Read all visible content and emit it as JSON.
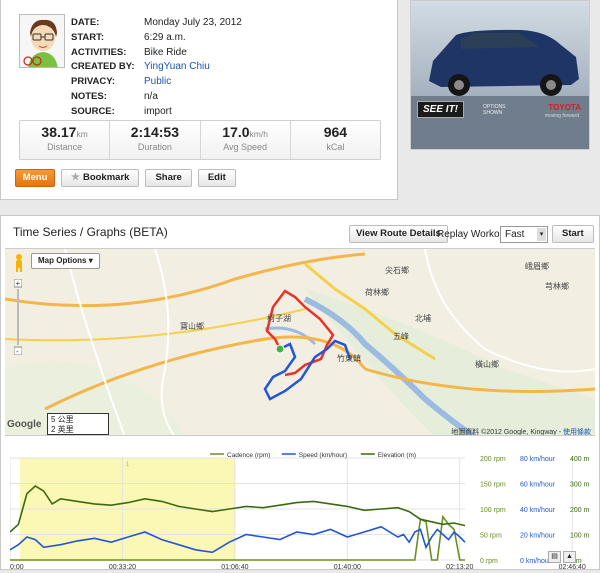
{
  "activity": {
    "fields": [
      {
        "key": "DATE:",
        "value": "Monday July 23, 2012",
        "link": false
      },
      {
        "key": "START:",
        "value": "6:29 a.m.",
        "link": false
      },
      {
        "key": "ACTIVITIES:",
        "value": "Bike Ride",
        "link": false
      },
      {
        "key": "CREATED BY:",
        "value": "YingYuan Chiu",
        "link": true
      },
      {
        "key": "PRIVACY:",
        "value": "Public",
        "link": true
      },
      {
        "key": "NOTES:",
        "value": "n/a",
        "link": false
      },
      {
        "key": "SOURCE:",
        "value": "import",
        "link": false
      }
    ],
    "stats": [
      {
        "value": "38.17",
        "unit": "km",
        "label": "Distance"
      },
      {
        "value": "2:14:53",
        "unit": "",
        "label": "Duration"
      },
      {
        "value": "17.0",
        "unit": "km/h",
        "label": "Avg Speed"
      },
      {
        "value": "964",
        "unit": "",
        "label": "kCal"
      }
    ],
    "buttons": {
      "menu": "Menu",
      "bookmark": "Bookmark",
      "share": "Share",
      "edit": "Edit"
    }
  },
  "ad": {
    "cta": "SEE IT!",
    "options": "OPTIONS SHOWN",
    "brand": "TOYOTA",
    "tagline": "moving forward"
  },
  "graphs": {
    "title": "Time Series / Graphs (BETA)",
    "view_route": "View Route Details",
    "replay_label": "Replay Workout:",
    "replay_speed": "Fast",
    "start": "Start"
  },
  "map": {
    "options": "Map Options",
    "scale_1": "5 公里",
    "scale_2": "2 英里",
    "logo": "Google",
    "copyright": "地圖資料 ©2012 Google, Kingway - ",
    "terms": "使用條款",
    "places": [
      "荷林鄉",
      "竹東鎮",
      "寶山鄉",
      "峨眉鄉",
      "橫山鄉",
      "芎林鄉",
      "五峰",
      "北埔",
      "柯子湖",
      "尖石鄉"
    ],
    "route_colors": {
      "red": "#e8322b",
      "blue": "#2255d8"
    }
  },
  "chart_data": {
    "type": "line",
    "x_ticks": [
      "00:00:00",
      "00:33:20",
      "01:06:40",
      "01:40:00",
      "02:13:20",
      "02:46:40"
    ],
    "x_seconds_max": 8093,
    "highlight_range": [
      "00:03:00",
      "01:06:40"
    ],
    "highlight_marker": "1",
    "legend_top": true,
    "series": [
      {
        "name": "Cadence (rpm)",
        "color": "#6b8e23",
        "axis_ticks": [
          "0 rpm",
          "50 rpm",
          "100 rpm",
          "150 rpm",
          "200 rpm"
        ],
        "ylim": [
          0,
          200
        ],
        "x": [
          0,
          300,
          600,
          900,
          1200,
          1500,
          1800,
          2100,
          2400,
          2700,
          3000,
          3300,
          3600,
          3900,
          4000,
          4200,
          4600,
          5000,
          5400,
          5800,
          6200,
          6600,
          6800,
          6900,
          7000,
          7100,
          7200,
          7300,
          7400,
          7500,
          7600,
          7700,
          7800,
          7900,
          8000,
          8093
        ],
        "values": [
          0,
          0,
          0,
          0,
          0,
          0,
          0,
          0,
          0,
          0,
          0,
          0,
          0,
          0,
          0,
          0,
          0,
          0,
          0,
          0,
          0,
          0,
          0,
          0,
          0,
          0,
          0,
          80,
          75,
          0,
          0,
          85,
          70,
          60,
          0,
          0
        ]
      },
      {
        "name": "Speed (km/hour)",
        "color": "#2255d8",
        "axis_ticks": [
          "0 km/hour",
          "20 km/hour",
          "40 km/hour",
          "60 km/hour",
          "80 km/hour"
        ],
        "ylim": [
          0,
          80
        ],
        "x": [
          0,
          150,
          300,
          450,
          600,
          900,
          1200,
          1500,
          1800,
          2100,
          2400,
          2700,
          3000,
          3300,
          3600,
          3900,
          4200,
          4500,
          4800,
          5100,
          5400,
          5700,
          6000,
          6300,
          6600,
          6900,
          7000,
          7100,
          7200,
          7300,
          7400,
          7500,
          7600,
          7700,
          7800,
          7900,
          8000,
          8093
        ],
        "values": [
          8,
          12,
          18,
          16,
          10,
          12,
          15,
          17,
          14,
          18,
          22,
          16,
          12,
          8,
          6,
          14,
          20,
          18,
          16,
          22,
          20,
          24,
          18,
          22,
          26,
          18,
          20,
          14,
          22,
          24,
          10,
          18,
          24,
          20,
          16,
          22,
          18,
          14
        ]
      },
      {
        "name": "Elevation (m)",
        "color": "#3a6b11",
        "axis_ticks": [
          "0 m",
          "100 m",
          "200 m",
          "300 m",
          "400 m"
        ],
        "ylim": [
          0,
          400
        ],
        "x": [
          0,
          150,
          300,
          450,
          600,
          750,
          900,
          1200,
          1500,
          1800,
          2100,
          2400,
          2700,
          3000,
          3300,
          3600,
          3900,
          4200,
          4500,
          4800,
          5100,
          5400,
          5700,
          6000,
          6300,
          6600,
          6900,
          7100,
          7300,
          7500,
          7700,
          7900,
          8093
        ],
        "values": [
          110,
          140,
          260,
          290,
          270,
          220,
          240,
          230,
          220,
          215,
          225,
          240,
          230,
          210,
          200,
          190,
          200,
          210,
          205,
          215,
          225,
          230,
          220,
          210,
          195,
          200,
          205,
          190,
          160,
          150,
          140,
          145,
          135
        ]
      }
    ]
  }
}
